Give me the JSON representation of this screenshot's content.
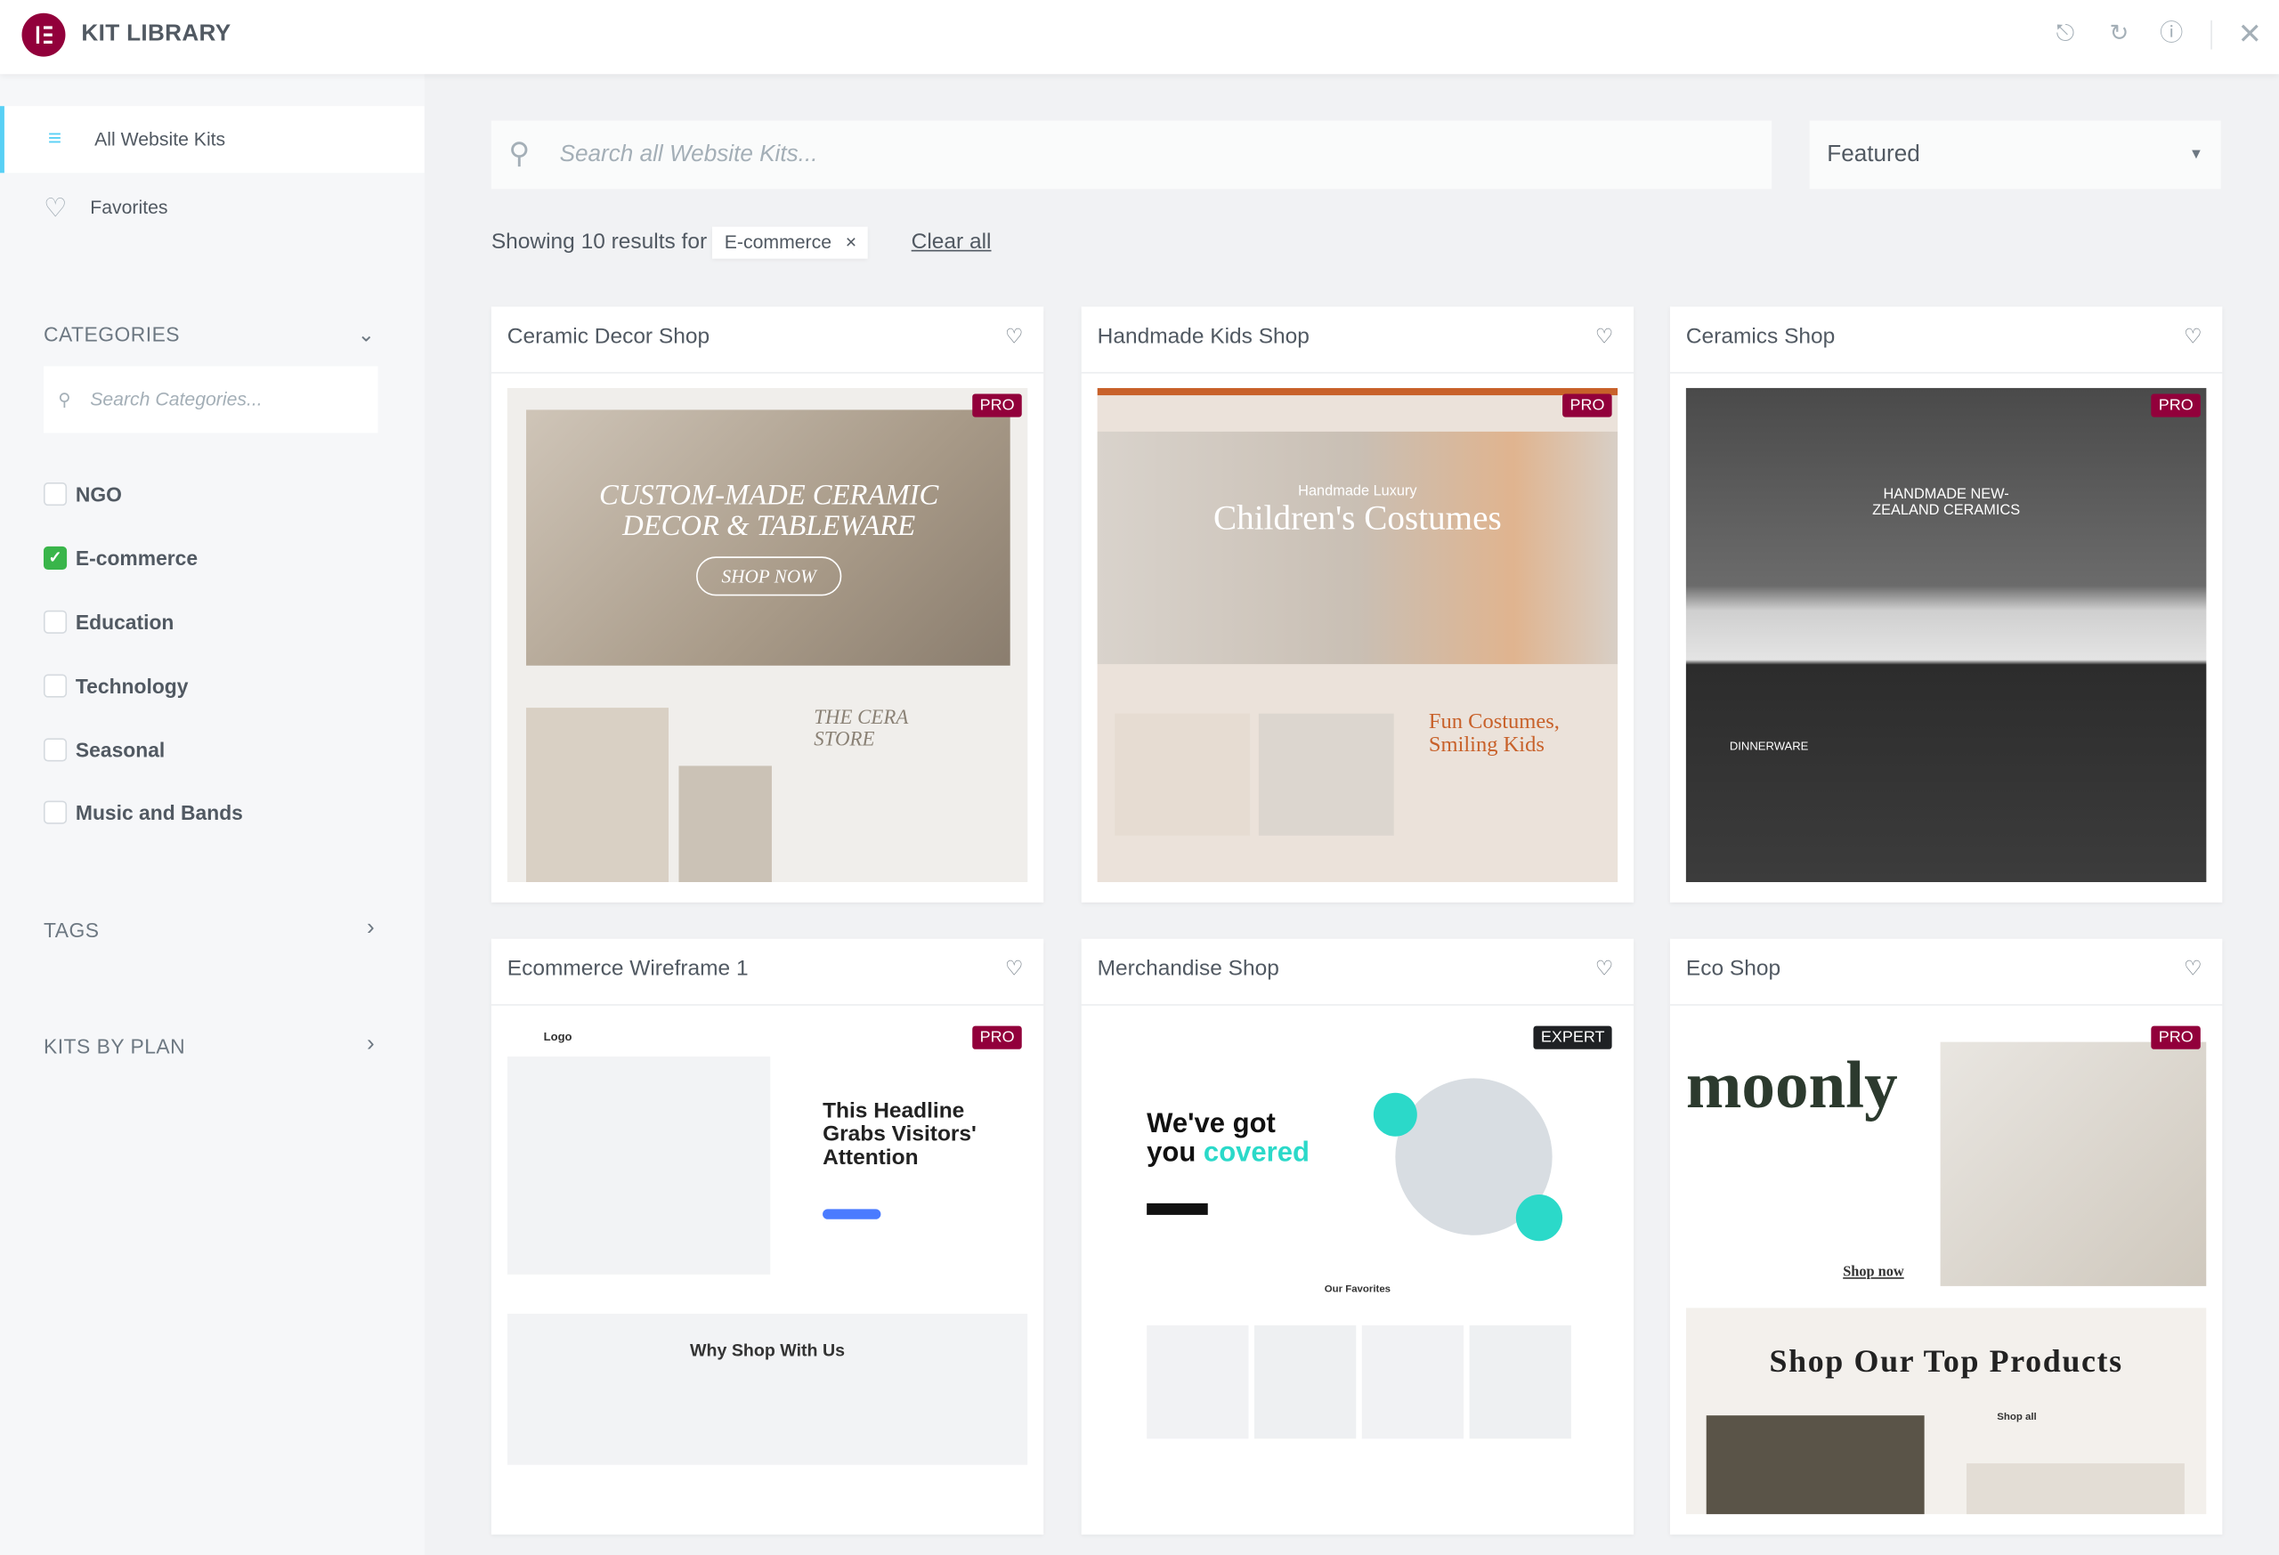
{
  "header": {
    "title": "KIT LIBRARY",
    "icons": [
      "upload-icon",
      "sync-icon",
      "info-icon",
      "close-icon"
    ]
  },
  "sidebar": {
    "nav": [
      {
        "label": "All Website Kits",
        "icon": "filter-icon",
        "active": true
      },
      {
        "label": "Favorites",
        "icon": "heart-icon",
        "active": false
      }
    ],
    "categories_title": "CATEGORIES",
    "categories_search_placeholder": "Search Categories...",
    "categories": [
      {
        "label": "NGO",
        "checked": false
      },
      {
        "label": "E-commerce",
        "checked": true
      },
      {
        "label": "Education",
        "checked": false
      },
      {
        "label": "Technology",
        "checked": false
      },
      {
        "label": "Seasonal",
        "checked": false
      },
      {
        "label": "Music and Bands",
        "checked": false
      }
    ],
    "tags_title": "TAGS",
    "plan_title": "KITS BY PLAN"
  },
  "main": {
    "search_placeholder": "Search all Website Kits...",
    "sort_value": "Featured",
    "results_text": "Showing 10 results for",
    "filter_chip": "E-commerce",
    "clear_all": "Clear all",
    "kits": [
      {
        "title": "Ceramic Decor Shop",
        "badge": "PRO",
        "preview": [
          "CUSTOM-MADE CERAMIC",
          "DECOR & TABLEWARE",
          "SHOP NOW",
          "THE CERA",
          "STORE"
        ]
      },
      {
        "title": "Handmade Kids Shop",
        "badge": "PRO",
        "preview": [
          "Handmade Luxury",
          "Children's Costumes",
          "Fun Costumes,",
          "Smiling Kids"
        ]
      },
      {
        "title": "Ceramics Shop",
        "badge": "PRO",
        "preview": [
          "HANDMADE NEW-",
          "ZEALAND CERAMICS",
          "DINNERWARE"
        ]
      },
      {
        "title": "Ecommerce Wireframe 1",
        "badge": "PRO",
        "preview": [
          "Logo",
          "This Headline",
          "Grabs Visitors'",
          "Attention",
          "Why Shop With Us"
        ]
      },
      {
        "title": "Merchandise Shop",
        "badge": "EXPERT",
        "preview": [
          "We've got",
          "you",
          "covered",
          "Our Favorites"
        ]
      },
      {
        "title": "Eco Shop",
        "badge": "PRO",
        "preview": [
          "moonly",
          "Shop now",
          "Shop Our Top Products",
          "Shop all"
        ]
      }
    ]
  },
  "colors": {
    "brand": "#92003b",
    "accent": "#58d0f5",
    "checked": "#39b54a"
  }
}
